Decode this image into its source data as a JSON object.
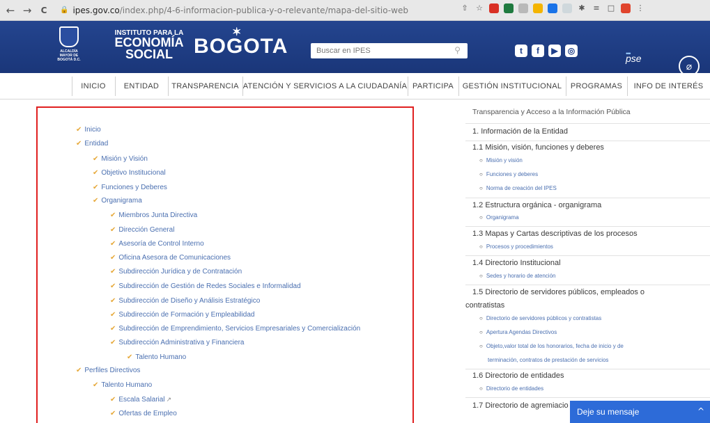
{
  "browser": {
    "back": "←",
    "forward": "→",
    "reload": "C",
    "url_domain": "ipes.gov.co",
    "url_path": "/index.php/4-6-informacion-publica-y-o-relevante/mapa-del-sitio-web"
  },
  "header": {
    "alcaldia_label": "ALCALDÍA MAYOR DE BOGOTÁ D.C.",
    "ipes_line1": "INSTITUTO PARA LA",
    "ipes_line2": "ECONOMÍA",
    "ipes_line3": "SOCIAL",
    "bogota": "BOGOTA",
    "search_placeholder": "Buscar en IPES",
    "pse": "pse"
  },
  "menu": [
    {
      "label": "INICIO"
    },
    {
      "label": "ENTIDAD"
    },
    {
      "label": "TRANSPARENCIA"
    },
    {
      "label": "ATENCIÓN Y SERVICIOS A LA CIUDADANÍA"
    },
    {
      "label": "PARTICIPA"
    },
    {
      "label": "GESTIÓN INSTITUCIONAL"
    },
    {
      "label": "PROGRAMAS"
    },
    {
      "label": "INFO DE INTERÉS"
    }
  ],
  "sitemap": [
    {
      "label": "Inicio"
    },
    {
      "label": "Entidad"
    },
    {
      "label": "Misión y Visión"
    },
    {
      "label": "Objetivo Institucional"
    },
    {
      "label": "Funciones y Deberes"
    },
    {
      "label": "Organigrama"
    },
    {
      "label": "Miembros Junta Directiva"
    },
    {
      "label": "Dirección General"
    },
    {
      "label": "Asesoría de Control Interno"
    },
    {
      "label": "Oficina Asesora de Comunicaciones"
    },
    {
      "label": "Subdirección Jurídica y de Contratación"
    },
    {
      "label": "Subdirección de Gestión de Redes Sociales e Informalidad"
    },
    {
      "label": "Subdirección de Diseño y Análisis Estratégico"
    },
    {
      "label": "Subdirección de Formación y Empleabilidad"
    },
    {
      "label": "Subdirección de Emprendimiento, Servicios Empresariales y Comercialización"
    },
    {
      "label": "Subdirección Administrativa y Financiera"
    },
    {
      "label": "Talento Humano"
    },
    {
      "label": "Perfiles Directivos"
    },
    {
      "label": "Talento Humano"
    },
    {
      "label": "Escala Salarial"
    },
    {
      "label": "Ofertas de Empleo"
    }
  ],
  "right": {
    "title": "Transparencia y Acceso a la Información Pública",
    "h1": "1. Información de la Entidad",
    "h1_1": "1.1 Misión, visión, funciones y deberes",
    "s1_1a": "Misión y visión",
    "s1_1b": "Funciones y deberes",
    "s1_1c": "Norma de creación del IPES",
    "h1_2": "1.2 Estructura orgánica - organigrama",
    "s1_2a": "Organigrama",
    "h1_3": "1.3 Mapas y Cartas descriptivas de los procesos",
    "s1_3a": "Procesos y procedimientos",
    "h1_4": "1.4 Directorio Institucional",
    "s1_4a": "Sedes y horario de atención",
    "h1_5a": "1.5 Directorio de servidores públicos, empleados o",
    "h1_5b": "contratistas",
    "s1_5a": "Directorio de servidores públicos y contratistas",
    "s1_5b": "Apertura Agendas Directivos",
    "s1_5c": "Objeto,valor total de los honorarios, fecha de inicio y de",
    "s1_5d": "terminación, contratos de prestación de servicios",
    "h1_6": "1.6 Directorio de entidades",
    "s1_6a": "Directorio de entidades",
    "h1_7": "1.7 Directorio de agremiacio"
  },
  "chat": {
    "label": "Deje su mensaje",
    "chevron": "^"
  }
}
